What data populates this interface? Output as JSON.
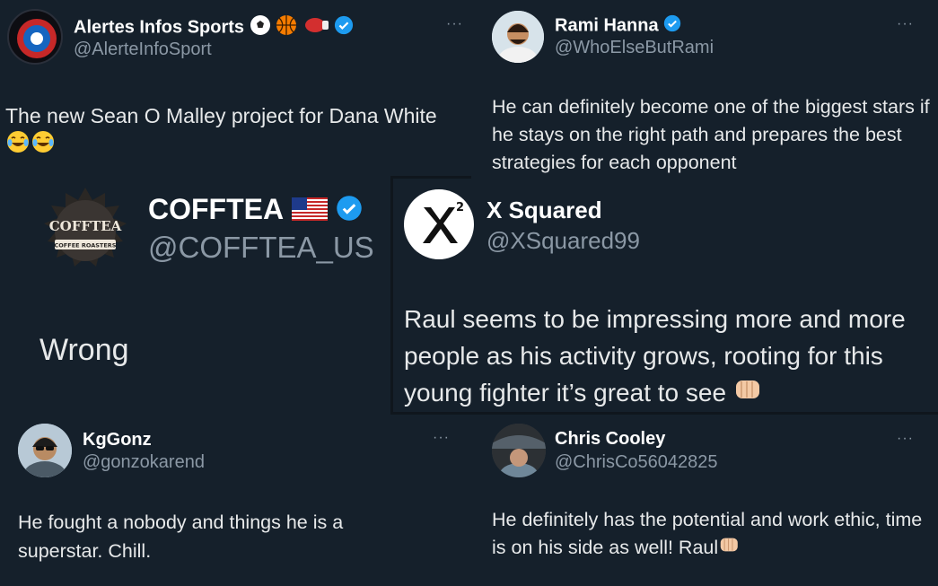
{
  "tweets": {
    "alertes": {
      "name": "Alertes Infos Sports",
      "handle": "@AlerteInfoSport",
      "text": "The new Sean O Malley project for Dana White",
      "more": "···"
    },
    "rami": {
      "name": "Rami Hanna",
      "handle": "@WhoElseButRami",
      "text": "He can definitely become one of the biggest stars if he stays on the right path and prepares the best strategies for each opponent",
      "more": "···"
    },
    "cofftea": {
      "name": "COFFTEA",
      "handle": "@COFFTEA_US",
      "text": "Wrong",
      "logo_text": "COFFTEA",
      "logo_sub": "COFFEE ROASTERS"
    },
    "xsquared": {
      "name": "X Squared",
      "handle": "@XSquared99",
      "text": "Raul seems to be impressing more and more people as his activity grows, rooting for this young fighter it’s great to see"
    },
    "kggonz": {
      "name": "KgGonz",
      "handle": "@gonzokarend",
      "text": "He fought a nobody and things he is a superstar. Chill.",
      "more": "···"
    },
    "chris": {
      "name": "Chris Cooley",
      "handle": "@ChrisCo56042825",
      "text": "He definitely has the potential and work ethic, time is on his side as well!  Raul",
      "more": "···"
    }
  },
  "colors": {
    "background": "#15202b",
    "verified": "#1d9bf0",
    "handle": "#8b98a5"
  }
}
